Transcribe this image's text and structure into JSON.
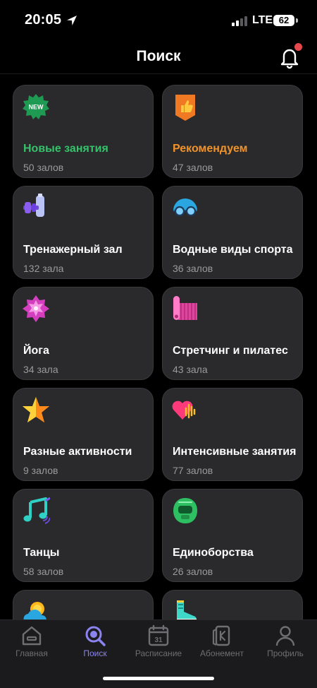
{
  "status_bar": {
    "time": "20:05",
    "network": "LTE",
    "battery": "62"
  },
  "header": {
    "title": "Поиск"
  },
  "categories": [
    {
      "title": "Новые занятия",
      "count": "50 залов",
      "title_color": "#34c26b",
      "icon": "new-badge-icon",
      "badge": "NEW"
    },
    {
      "title": "Рекомендуем",
      "count": "47 залов",
      "title_color": "#f0932b",
      "icon": "thumbs-up-ribbon-icon"
    },
    {
      "title": "Тренажерный зал",
      "count": "132 зала",
      "title_color": "#ffffff",
      "icon": "dumbbell-icon"
    },
    {
      "title": "Водные виды спорта",
      "count": "36 залов",
      "title_color": "#ffffff",
      "icon": "swim-cap-icon"
    },
    {
      "title": "Йога",
      "count": "34 зала",
      "title_color": "#ffffff",
      "icon": "lotus-icon"
    },
    {
      "title": "Стретчинг и пилатес",
      "count": "43 зала",
      "title_color": "#ffffff",
      "icon": "yoga-mat-icon"
    },
    {
      "title": "Разные активности",
      "count": "9 залов",
      "title_color": "#ffffff",
      "icon": "star-icon"
    },
    {
      "title": "Интенсивные занятия",
      "count": "77 залов",
      "title_color": "#ffffff",
      "icon": "heart-pulse-icon"
    },
    {
      "title": "Танцы",
      "count": "58 залов",
      "title_color": "#ffffff",
      "icon": "music-note-icon"
    },
    {
      "title": "Единоборства",
      "count": "26 залов",
      "title_color": "#ffffff",
      "icon": "boxing-helmet-icon"
    },
    {
      "title": "",
      "count": "",
      "title_color": "#ffffff",
      "icon": "weather-icon"
    },
    {
      "title": "",
      "count": "",
      "title_color": "#ffffff",
      "icon": "sneaker-icon"
    }
  ],
  "tabbar": {
    "active_color": "#8a83f0",
    "items": [
      {
        "label": "Главная",
        "icon": "home-icon"
      },
      {
        "label": "Поиск",
        "icon": "search-icon"
      },
      {
        "label": "Расписание",
        "icon": "calendar-icon",
        "calendar_day": "31"
      },
      {
        "label": "Абонемент",
        "icon": "membership-card-icon"
      },
      {
        "label": "Профиль",
        "icon": "profile-icon"
      }
    ]
  }
}
